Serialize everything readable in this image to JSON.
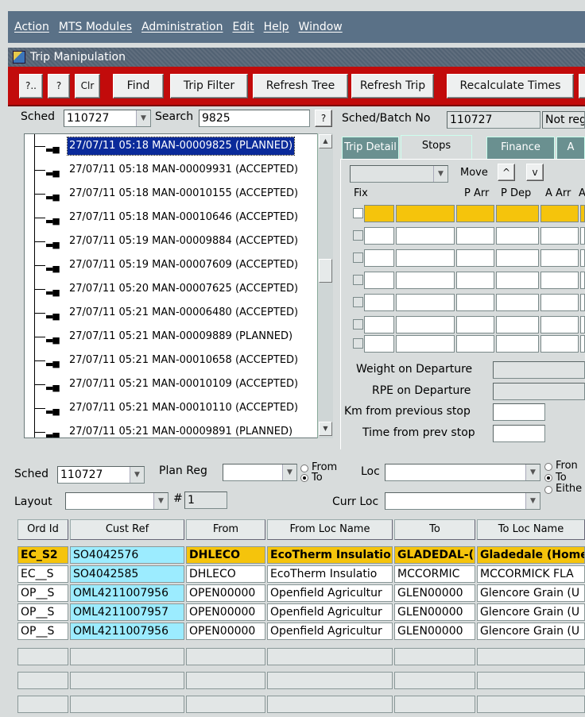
{
  "menubar": {
    "items": [
      "Action",
      "MTS Modules",
      "Administration",
      "Edit",
      "Help",
      "Window"
    ]
  },
  "window": {
    "title": "Trip Manipulation"
  },
  "toolbar": {
    "buttons": [
      "?..",
      "?",
      "Clr",
      "Find",
      "Trip Filter",
      "Refresh Tree",
      "Refresh Trip",
      "Recalculate Times"
    ]
  },
  "search": {
    "sched_label": "Sched",
    "sched_value": "110727",
    "search_label": "Search",
    "search_value": "9825",
    "help_label": "?"
  },
  "sched_batch": {
    "label": "Sched/Batch No",
    "value": "110727",
    "status": "Not reg"
  },
  "tree": {
    "items": [
      "27/07/11 05:18 MAN-00009825 (PLANNED)",
      "27/07/11 05:18 MAN-00009931 (ACCEPTED)",
      "27/07/11 05:18 MAN-00010155 (ACCEPTED)",
      "27/07/11 05:18 MAN-00010646 (ACCEPTED)",
      "27/07/11 05:19 MAN-00009884 (ACCEPTED)",
      "27/07/11 05:19 MAN-00007609 (ACCEPTED)",
      "27/07/11 05:20 MAN-00007625 (ACCEPTED)",
      "27/07/11 05:21 MAN-00006480 (ACCEPTED)",
      "27/07/11 05:21 MAN-00009889 (PLANNED)",
      "27/07/11 05:21 MAN-00010658 (ACCEPTED)",
      "27/07/11 05:21 MAN-00010109 (ACCEPTED)",
      "27/07/11 05:21 MAN-00010110 (ACCEPTED)",
      "27/07/11 05:21 MAN-00009891 (PLANNED)"
    ]
  },
  "tabs": [
    "Trip Detail",
    "Stops",
    "Finance",
    "A"
  ],
  "stops": {
    "move_label": "Move",
    "up_label": "^",
    "down_label": "v",
    "columns": [
      "Fix",
      "P Arr",
      "P Dep",
      "A Arr",
      "A"
    ],
    "weight_label": "Weight on Departure",
    "rpe_label": "RPE on Departure",
    "km_label": "Km from previous stop",
    "time_label": "Time from prev stop"
  },
  "filters": {
    "sched_label": "Sched",
    "sched_value": "110727",
    "plan_reg_label": "Plan Reg",
    "from_label": "From",
    "to_label": "To",
    "loc_label": "Loc",
    "layout_label": "Layout",
    "hash_label": "#",
    "hash_value": "1",
    "curr_loc_label": "Curr Loc",
    "right_from_label": "Fron",
    "right_to_label": "To",
    "either_label": "Eithe"
  },
  "grid": {
    "columns": [
      "Ord Id",
      "Cust Ref",
      "From",
      "From Loc Name",
      "To",
      "To Loc Name"
    ],
    "rows": [
      [
        "EC_S2",
        "SO4042576",
        "DHLECO",
        "EcoTherm Insulatio",
        "GLADEDAL-(",
        "Gladedale (Home"
      ],
      [
        "EC__S",
        "SO4042585",
        "DHLECO",
        "EcoTherm Insulatio",
        "MCCORMIC",
        "MCCORMICK FLA"
      ],
      [
        "OP__S",
        "OML4211007956",
        "OPEN00000",
        "Openfield Agricultur",
        "GLEN00000",
        "Glencore Grain (U"
      ],
      [
        "OP__S",
        "OML4211007957",
        "OPEN00000",
        "Openfield Agricultur",
        "GLEN00000",
        "Glencore Grain (U"
      ],
      [
        "OP__S",
        "OML4211007956",
        "OPEN00000",
        "Openfield Agricultur",
        "GLEN00000",
        "Glencore Grain (U"
      ]
    ]
  },
  "colors": {
    "toolbar": "#c20b0b",
    "selected_row": "#f5c40c",
    "cust_ref": "#9cecff",
    "selection": "#0a2a9a"
  }
}
